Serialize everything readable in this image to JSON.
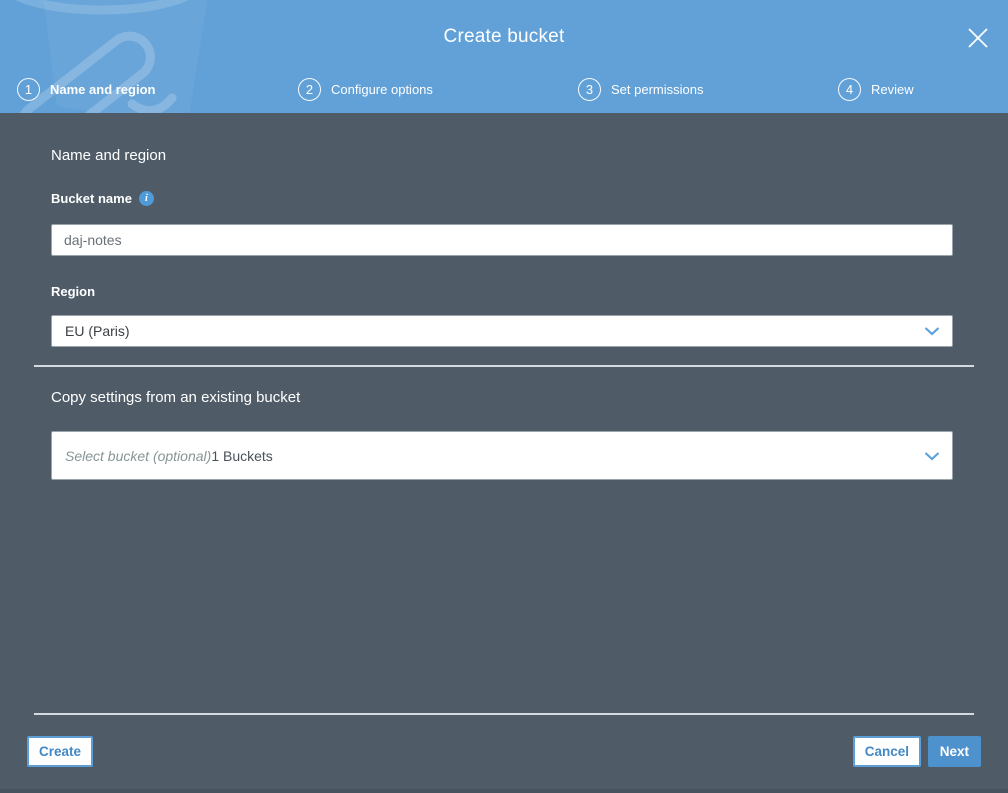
{
  "modal": {
    "title": "Create bucket"
  },
  "steps": [
    {
      "number": "1",
      "label": "Name and region"
    },
    {
      "number": "2",
      "label": "Configure options"
    },
    {
      "number": "3",
      "label": "Set permissions"
    },
    {
      "number": "4",
      "label": "Review"
    }
  ],
  "form": {
    "section_heading": "Name and region",
    "bucket_name": {
      "label": "Bucket name",
      "value": "daj-notes"
    },
    "region": {
      "label": "Region",
      "selected": "EU (Paris)"
    },
    "copy_settings": {
      "heading": "Copy settings from an existing bucket",
      "placeholder": "Select bucket (optional)",
      "buckets_count": "1 Buckets"
    }
  },
  "footer": {
    "create_label": "Create",
    "cancel_label": "Cancel",
    "next_label": "Next"
  },
  "colors": {
    "header_blue": "#61a1d7",
    "body_slate": "#4f5c68",
    "accent_blue": "#4d92cc"
  }
}
